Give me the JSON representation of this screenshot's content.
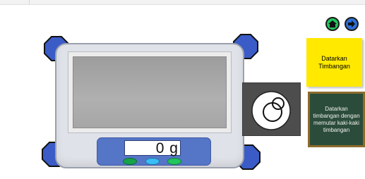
{
  "scale": {
    "display_value": "0 g",
    "buttons": [
      "green",
      "blue",
      "green"
    ]
  },
  "navigation": {
    "home_icon": "home-icon",
    "next_icon": "arrow-right-icon"
  },
  "instructions": {
    "level_note": "Datarkan Timbangan",
    "chalkboard_text": "Datarkan timbangan dengan memutar kaki-kaki timbangan"
  },
  "colors": {
    "panel": "#5575c6",
    "feet": "#3b5cc7",
    "note": "#ffe900",
    "chalkboard": "#2b4c3a"
  }
}
